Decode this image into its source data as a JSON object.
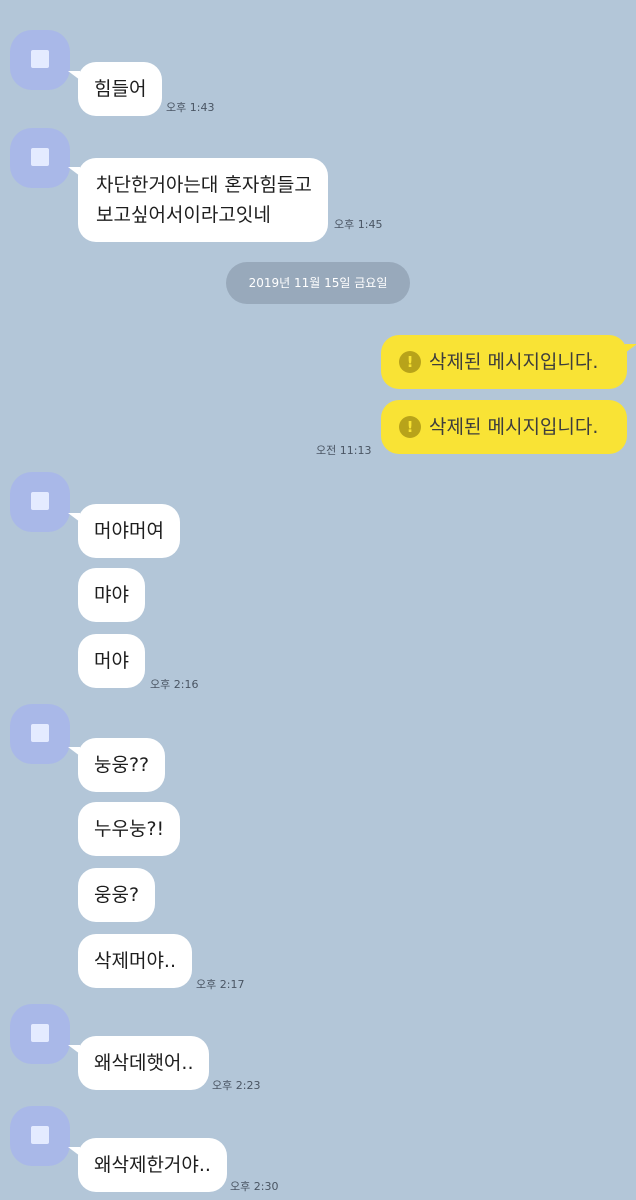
{
  "date_divider": "2019년 11월 15일 금요일",
  "messages": {
    "m1": {
      "text": "힘들어",
      "time": "오후 1:43"
    },
    "m2": {
      "line1": "차단한거아는대 혼자힘들고",
      "line2": "보고싶어서이라고잇네",
      "time": "오후 1:45"
    },
    "m3": {
      "text": "삭제된 메시지입니다."
    },
    "m4": {
      "text": "삭제된 메시지입니다.",
      "time": "오전 11:13"
    },
    "m5": {
      "text": "머야머여"
    },
    "m6": {
      "text": "먀야"
    },
    "m7": {
      "text": "머야",
      "time": "오후 2:16"
    },
    "m8": {
      "text": "눙웅??"
    },
    "m9": {
      "text": "누우눙?!"
    },
    "m10": {
      "text": "웅웅?"
    },
    "m11": {
      "text": "삭제머야..",
      "time": "오후 2:17"
    },
    "m12": {
      "text": "왜삭데햇어..",
      "time": "오후 2:23"
    },
    "m13": {
      "text": "왜삭제한거야..",
      "time": "오후 2:30"
    }
  },
  "icons": {
    "deleted": "exclamation-circle-icon",
    "deleted_glyph": "!"
  },
  "colors": {
    "background": "#b3c6d8",
    "incoming_bubble": "#ffffff",
    "outgoing_bubble": "#f9e335",
    "avatar": "#a9b8e8",
    "date_pill": "#98a9bb"
  }
}
